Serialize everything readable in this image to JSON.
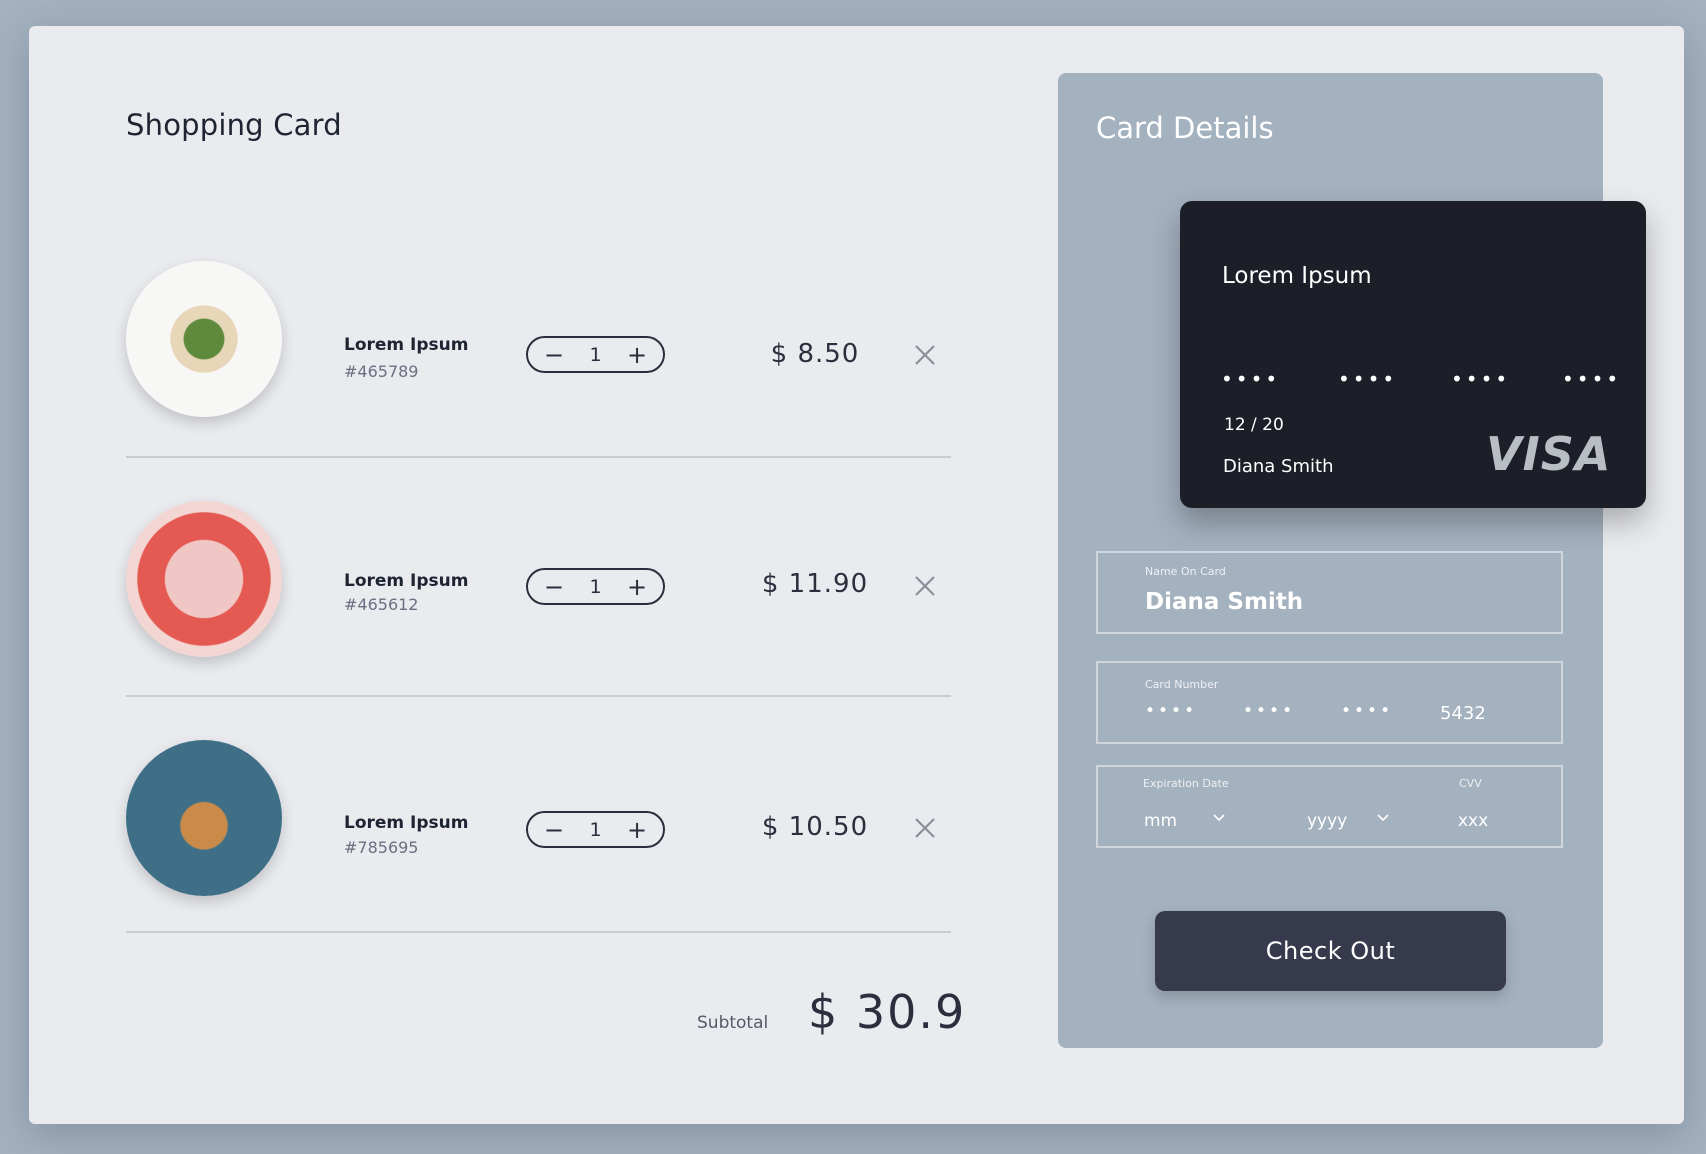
{
  "cart": {
    "title": "Shopping Card",
    "items": [
      {
        "name": "Lorem Ipsum",
        "sku": "#465789",
        "quantity": "1",
        "price": "$ 8.50",
        "minus": "−",
        "plus": "+"
      },
      {
        "name": "Lorem Ipsum",
        "sku": "#465612",
        "quantity": "1",
        "price": "$ 11.90",
        "minus": "−",
        "plus": "+"
      },
      {
        "name": "Lorem Ipsum",
        "sku": "#785695",
        "quantity": "1",
        "price": "$ 10.50",
        "minus": "−",
        "plus": "+"
      }
    ],
    "subtotal_label": "Subtotal",
    "subtotal_value": "$ 30.9"
  },
  "payment": {
    "title": "Card Details",
    "card": {
      "title": "Lorem Ipsum",
      "number_groups": [
        "••••",
        "••••",
        "••••",
        "••••"
      ],
      "expiry": "12 / 20",
      "holder": "Diana Smith",
      "brand": "VISA"
    },
    "name_field": {
      "label": "Name On Card",
      "value": "Diana Smith"
    },
    "number_field": {
      "label": "Card Number",
      "groups": [
        "••••",
        "••••",
        "••••"
      ],
      "last4": "5432"
    },
    "expiry_field": {
      "label": "Expiration Date",
      "month": "mm",
      "year": "yyyy"
    },
    "cvv_field": {
      "label": "CVV",
      "value": "xxx"
    },
    "checkout_label": "Check Out"
  },
  "colors": {
    "background": "#a4b1bf",
    "window": "#e9ebef",
    "panel": "#a4b1bf",
    "card": "#1c1f28",
    "button": "#363a4c",
    "text": "#1f2433"
  },
  "icons": [
    "minus-icon",
    "plus-icon",
    "close-icon",
    "chevron-down-icon",
    "visa-logo"
  ]
}
